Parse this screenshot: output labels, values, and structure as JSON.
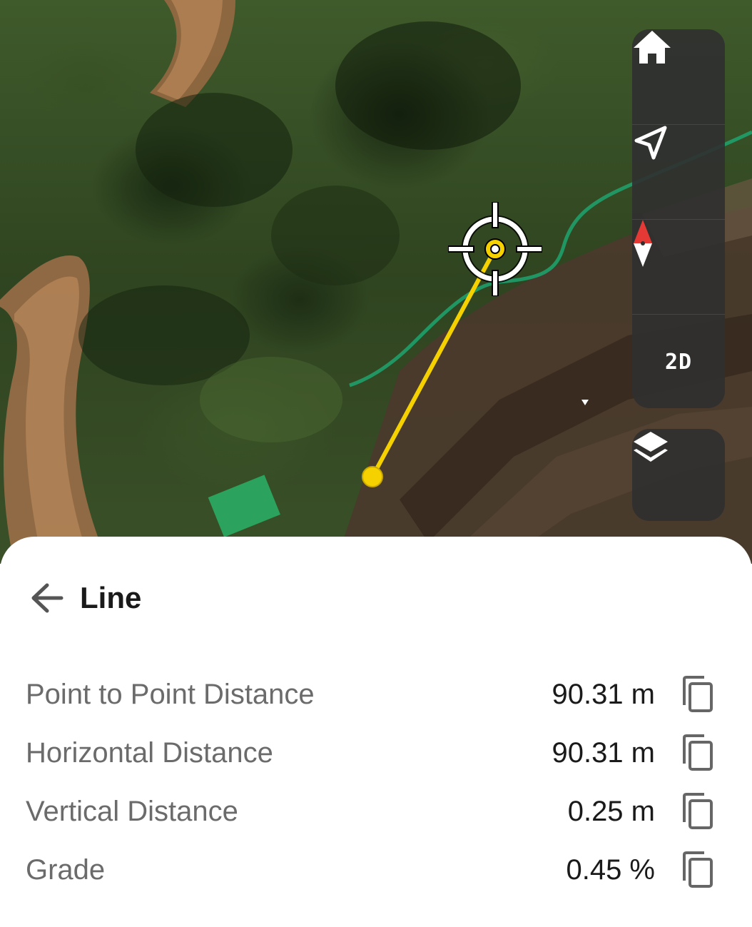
{
  "toolbar": {
    "home_icon": "home-icon",
    "locate_icon": "navigation-arrow-icon",
    "compass_icon": "compass-icon",
    "view_mode_label": "2D",
    "layers_icon": "layers-icon"
  },
  "colors": {
    "measure_line": "#f5d100",
    "fence_line": "#1f9e6a",
    "toolbar_bg": "#303030"
  },
  "sheet": {
    "back_icon": "arrow-left-icon",
    "title": "Line",
    "rows": [
      {
        "label": "Point to Point Distance",
        "value": "90.31 m",
        "copy_icon": "copy-icon"
      },
      {
        "label": "Horizontal Distance",
        "value": "90.31 m",
        "copy_icon": "copy-icon"
      },
      {
        "label": "Vertical Distance",
        "value": "0.25 m",
        "copy_icon": "copy-icon"
      },
      {
        "label": "Grade",
        "value": "0.45 %",
        "copy_icon": "copy-icon"
      }
    ]
  }
}
